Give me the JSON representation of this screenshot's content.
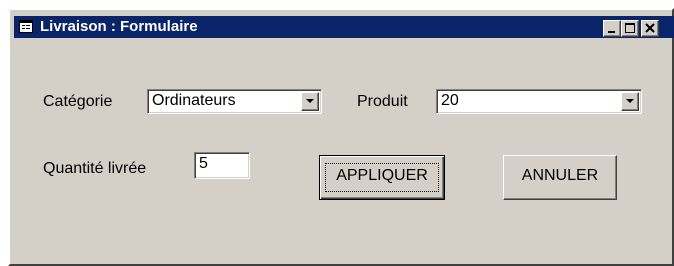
{
  "window": {
    "title": "Livraison : Formulaire"
  },
  "form": {
    "categorie_label": "Catégorie",
    "categorie_value": "Ordinateurs",
    "produit_label": "Produit",
    "produit_value": "20",
    "quantite_label": "Quantité livrée",
    "quantite_value": "5"
  },
  "buttons": {
    "apply_label": "APPLIQUER",
    "cancel_label": "ANNULER"
  },
  "icons": {
    "title": "form-icon",
    "minimize": "minimize-icon",
    "maximize": "maximize-icon",
    "close": "close-icon",
    "dropdown": "chevron-down-icon"
  }
}
